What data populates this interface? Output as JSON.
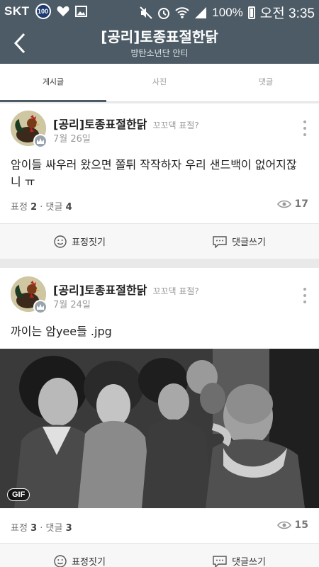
{
  "status_bar": {
    "carrier": "SKT",
    "network_badge": "100",
    "battery": "100%",
    "time": "오전 3:35",
    "icons": [
      "heart-icon",
      "image-icon",
      "mute-icon",
      "alarm-icon",
      "wifi-icon",
      "signal-icon",
      "battery-icon"
    ]
  },
  "header": {
    "title": "[공리]토종표절한닭",
    "subtitle": "방탄소년단 안티",
    "bg_color": "#4d5b66"
  },
  "tabs": [
    {
      "label": "게시글",
      "active": true
    },
    {
      "label": "사진",
      "active": false
    },
    {
      "label": "댓글",
      "active": false
    }
  ],
  "posts": [
    {
      "author": "[공리]토종표절한닭",
      "author_sub": "꼬꼬댁 표절?",
      "date": "7월 26일",
      "text": "암이들 싸우러 왔으면 쫄튀 작작하자 우리 샌드백이 없어지잖니 ㅠ",
      "reactions_label": "표정",
      "reactions": "2",
      "comments_label": "댓글",
      "comments": "4",
      "views": "17",
      "action_react": "표정짓기",
      "action_comment": "댓글쓰기"
    },
    {
      "author": "[공리]토종표절한닭",
      "author_sub": "꼬꼬댁 표절?",
      "date": "7월 24일",
      "text": "까이는 암yee들 .jpg",
      "media_badge": "GIF",
      "reactions_label": "표정",
      "reactions": "3",
      "comments_label": "댓글",
      "comments": "3",
      "views": "15",
      "action_react": "표정짓기",
      "action_comment": "댓글쓰기"
    }
  ]
}
